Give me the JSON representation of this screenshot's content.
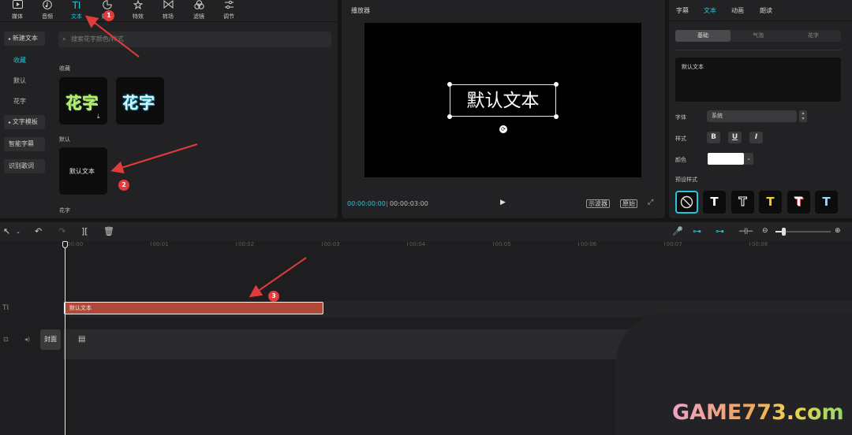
{
  "toolbar": {
    "tabs": [
      {
        "label": "媒体",
        "icon": "media-icon"
      },
      {
        "label": "音频",
        "icon": "audio-icon"
      },
      {
        "label": "文本",
        "icon": "text-icon",
        "active": true
      },
      {
        "label": "贴纸",
        "icon": "sticker-icon"
      },
      {
        "label": "特效",
        "icon": "effects-icon"
      },
      {
        "label": "转场",
        "icon": "transition-icon"
      },
      {
        "label": "滤镜",
        "icon": "filter-icon"
      },
      {
        "label": "调节",
        "icon": "adjust-icon"
      }
    ]
  },
  "library": {
    "categories": {
      "new_text": "新建文本",
      "favorites": "收藏",
      "default": "默认",
      "flower": "花字",
      "template": "文字模板",
      "smart_caption": "智能字幕",
      "lyrics": "识别歌词"
    },
    "search_placeholder": "搜索花字颜色/样式",
    "section_favorites": "收藏",
    "section_default": "默认",
    "section_flower": "花字",
    "flower_sample": "花字",
    "default_card_text": "默认文本"
  },
  "player": {
    "title": "播放器",
    "canvas_text": "默认文本",
    "time_current": "00:00:00:00",
    "time_separator": "|",
    "time_total": "00:00:03:00",
    "scope_button": "示波器",
    "ratio_button": "原始"
  },
  "inspector": {
    "tabs": {
      "subtitle": "字幕",
      "text": "文本",
      "animation": "动画",
      "read": "朗读"
    },
    "segments": {
      "basic": "基础",
      "bubble": "气泡",
      "flower": "花字"
    },
    "text_value": "默认文本",
    "font_label": "字体",
    "font_value": "系统",
    "style_label": "样式",
    "style_bold": "B",
    "style_underline": "U",
    "style_italic": "I",
    "color_label": "颜色",
    "color_value": "#ffffff",
    "preset_label": "预设样式",
    "presets": [
      "T",
      "T",
      "T",
      "T",
      "T"
    ]
  },
  "timeline": {
    "ticks": [
      "00:00",
      "00:01",
      "00:02",
      "00:03",
      "00:04",
      "00:05",
      "00:06",
      "00:07",
      "00:08"
    ],
    "clip_label": "默认文本",
    "cover_label": "封面"
  },
  "annotations": {
    "badge1": "1",
    "badge2": "2",
    "badge3": "3"
  },
  "watermark": {
    "text": "GAME773.com"
  },
  "colors": {
    "accent": "#26c4d8",
    "clip": "#b0493a",
    "annotation": "#e33b3b"
  }
}
